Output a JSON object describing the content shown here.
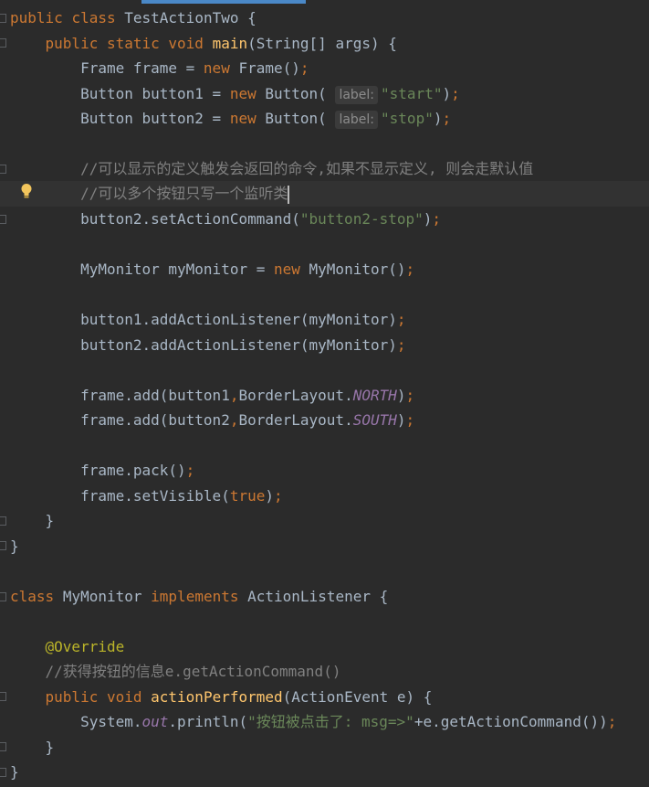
{
  "editor": {
    "lines": {
      "l1": [
        "public",
        "class",
        "TestActionTwo {"
      ],
      "l2": [
        "public",
        "static",
        "void",
        "main",
        "(String[] args) {"
      ],
      "l3": [
        "Frame frame = ",
        "new",
        "Frame()",
        ";"
      ],
      "l4": [
        "Button button1 = ",
        "new",
        "Button(",
        "label:",
        "\"start\"",
        ")",
        ";"
      ],
      "l5": [
        "Button button2 = ",
        "new",
        "Button(",
        "label:",
        "\"stop\"",
        ")",
        ";"
      ],
      "l6": [
        "//可以显示的定义触发会返回的命令,如果不显示定义, 则会走默认值"
      ],
      "l7": [
        "//可以多个按钮只写一个监听类"
      ],
      "l8": [
        "button2.setActionCommand(",
        "\"button2-stop\"",
        ")",
        ";"
      ],
      "l9": [
        "MyMonitor myMonitor = ",
        "new",
        "MyMonitor()",
        ";"
      ],
      "l10": [
        "button1.addActionListener(myMonitor)",
        ";"
      ],
      "l11": [
        "button2.addActionListener(myMonitor)",
        ";"
      ],
      "l12": [
        "frame.add(button1",
        ",",
        "BorderLayout.",
        "NORTH",
        ")",
        ";"
      ],
      "l13": [
        "frame.add(button2",
        ",",
        "BorderLayout.",
        "SOUTH",
        ")",
        ";"
      ],
      "l14": [
        "frame.pack()",
        ";"
      ],
      "l15": [
        "frame.setVisible(",
        "true",
        ")",
        ";"
      ],
      "l16": [
        "}"
      ],
      "l17": [
        "}"
      ],
      "l18": [
        "class",
        "MyMonitor",
        "implements",
        "ActionListener {"
      ],
      "l19": [
        "@Override"
      ],
      "l20": [
        "//获得按钮的信息e.getActionCommand()"
      ],
      "l21": [
        "public",
        "void",
        "actionPerformed",
        "(ActionEvent e) {"
      ],
      "l22": [
        "System.",
        "out",
        ".println(",
        "\"按钮被点击了: msg=>\"",
        "+e.getActionCommand())",
        ";"
      ],
      "l23": [
        "}"
      ],
      "l24": [
        "}"
      ]
    }
  },
  "icons": {
    "bulb": "lightbulb-icon"
  },
  "colors": {
    "background": "#2b2b2b",
    "keyword": "#cc7832",
    "function": "#ffc66d",
    "string": "#6a8759",
    "comment": "#808080",
    "annotation": "#bbb529",
    "constant": "#9876aa",
    "text": "#a9b7c6"
  }
}
